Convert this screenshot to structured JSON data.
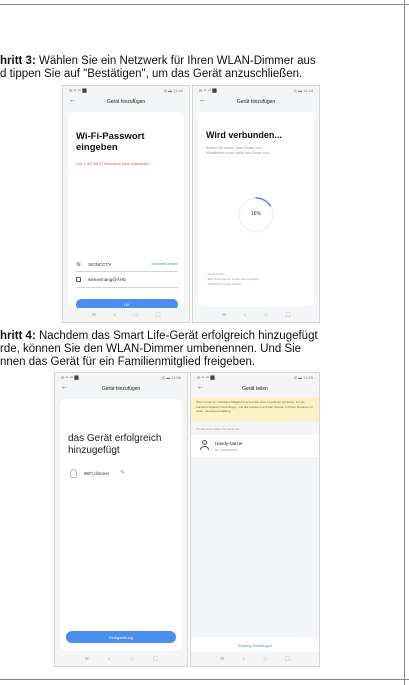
{
  "step3": {
    "label": "hritt 3:",
    "line1": " Wählen Sie ein Netzwerk für Ihren WLAN-Dimmer aus",
    "line2": "d tippen Sie auf \"Bestätigen\", um das Gerät anzuschließen."
  },
  "step4": {
    "label": "hritt 4:",
    "line1": " Nachdem das Smart Life-Gerät erfolgreich hinzugefügt",
    "line2": "rde, können Sie den WLAN-Dimmer umbenennen. Und Sie",
    "line3": "nnen das Gerät für ein Familienmitglied freigeben."
  },
  "nav": {
    "back": "‹",
    "home": "○",
    "recent": "□",
    "menu": "≡"
  },
  "phone1": {
    "status_left": "✉ ᵃˡˡ ⁴ᴳ ⬛",
    "status_right": "◎ ▬ 11:44",
    "header": "Gerät hinzufügen",
    "title_line1": "Wi-Fi-Passwort",
    "title_line2": "eingeben",
    "warning": "Nur 2,4G Wi-Fi-Netzwerk wird unterstützt",
    "ssid": "SIGNCCTV",
    "change_network": "Netzwerk ändern",
    "password": "wenxemang@ÂHE",
    "next": "OK"
  },
  "phone2": {
    "status_left": "✉ ᵃˡˡ ⁴ᴳ ⬛",
    "status_right": "◎ ▬ 11:44",
    "header": "Gerät hinzufügen",
    "title": "Wird verbunden...",
    "desc": "Achten Sie darauf, dass Router und Mobiltelefon in der Nähe des Geräts sind.",
    "progress_text": "16%",
    "progress": 0.16,
    "step1": "• Gerät finden",
    "step2": "• Das Gerät wird in Smart Life registriert",
    "step3": "• Initialisierung des Geräts"
  },
  "phone3": {
    "status_left": "✉ ᵃˡˡ ⁴ᴳ ⬛",
    "status_right": "◎ ▬ 11:58",
    "header": "Gerät hinzufügen",
    "success_line1": "das Gerät erfolgreich",
    "success_line2": "hinzugefügt",
    "device_name": "WiFi dimmer",
    "done": "Fertigstellung"
  },
  "phone4": {
    "status_left": "✉ ᵃˡˡ ⁴ᴳ ⬛",
    "status_right": "◎ ▬ 11:59",
    "header": "Gerät teilen",
    "notice": "Wenn er/sie ein ständiges Mitglied Ihrer Familie sind, empfehlen wir Ihnen, ihn als Familienmitglied hinzuzufügen, und alle Geräte und Smart Szenen in Ihrem Zuhause zu teilen. Familienverwaltung",
    "shared_label": "Die Benutzer teilen Ihr Gerät mit:",
    "user_name": "Handy-Nutzer",
    "user_id": "86-13000000000",
    "add_share": "Sharing hinzufügen"
  },
  "colors": {
    "blue": "#4a8ef0",
    "red": "#e15b3f",
    "notice_bg": "#fcf0c8"
  }
}
